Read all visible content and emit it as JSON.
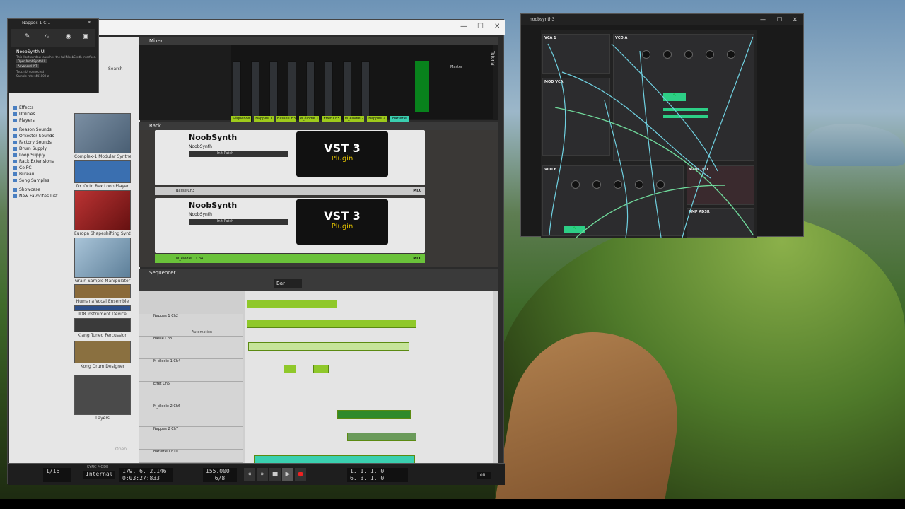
{
  "reason": {
    "window_title": "",
    "popup": {
      "title": "Nappes 1 C...",
      "heading": "NoobSynth UI",
      "desc": "This Host window launches the full NoobSynth interface.",
      "btn_open": "Open NoobSynth UI",
      "btn_advanced": "Advanced INT",
      "status1": "Touch UI connected",
      "status2": "Sample rate: 44100 Hz"
    },
    "browser": {
      "search_label": "Search",
      "nav_items": [
        "Effects",
        "Utilities",
        "Players",
        "Reason Sounds",
        "Orkester Sounds",
        "Factory Sounds",
        "Drum Supply",
        "Loop Supply",
        "Rack Extensions",
        "Ce PC",
        "Bureau",
        "Song Samples",
        "Showcase",
        "New Favorites List"
      ],
      "devices": [
        "Complex-1 Modular Synthesizer",
        "Dr. Octo Rex Loop Player",
        "Europa Shapeshifting Synthesizer",
        "Grain Sample Manipulator",
        "Humana Vocal Ensemble",
        "ID8 Instrument Device",
        "Klang Tuned Percussion",
        "Kong Drum Designer",
        "Layers"
      ],
      "open_label": "Open"
    },
    "mixer": {
      "header": "Mixer",
      "channels": [
        "Séquence Ch1",
        "Nappes 1 Ch2",
        "Basse Ch3",
        "M_élodie 1 Ch4",
        "Effet Ch5",
        "M_élodie 2 Ch6",
        "Nappes 2 Ch7",
        "Batterie Ch10"
      ],
      "master_label": "Master",
      "tutorial": "Tutorial"
    },
    "rack": {
      "header": "Rack",
      "devices": [
        {
          "name": "NoobSynth",
          "sub": "NoobSynth",
          "patch": "Init Patch",
          "vst_title": "VST 3",
          "vst_sub": "Plugin",
          "bar_label": "Basse Ch3",
          "mix": "MIX"
        },
        {
          "name": "NoobSynth",
          "sub": "NoobSynth",
          "patch": "Init Patch",
          "vst_title": "VST 3",
          "vst_sub": "Plugin",
          "bar_label": "M_élodie 1 Ch4",
          "mix": "MIX"
        }
      ]
    },
    "sequencer": {
      "header": "Sequencer",
      "snap_value": "Bar",
      "tracks": [
        "Nappes 1 Ch2",
        "Basse Ch3",
        "M_élodie 1 Ch4",
        "Effet Ch5",
        "M_élodie 2 Ch6",
        "Nappes 2 Ch7",
        "Batterie Ch10"
      ],
      "automation": "Automation"
    },
    "transport": {
      "quantize": "1/16",
      "sync_mode_label": "SYNC MODE",
      "sync_mode": "Internal",
      "position": "179. 6. 2.146",
      "time": "0:03:27:833",
      "tempo": "155.000",
      "signature": "6/8",
      "loop_l": "1. 1. 1.   0",
      "loop_r": "6. 3. 1.   0",
      "on": "ON"
    }
  },
  "plugin": {
    "title": "noobsynth3",
    "modules": [
      "VCA 1",
      "VCO A",
      "MOD VCA",
      "VCO B",
      "MAIN OUT",
      "AMP ADSR"
    ]
  }
}
